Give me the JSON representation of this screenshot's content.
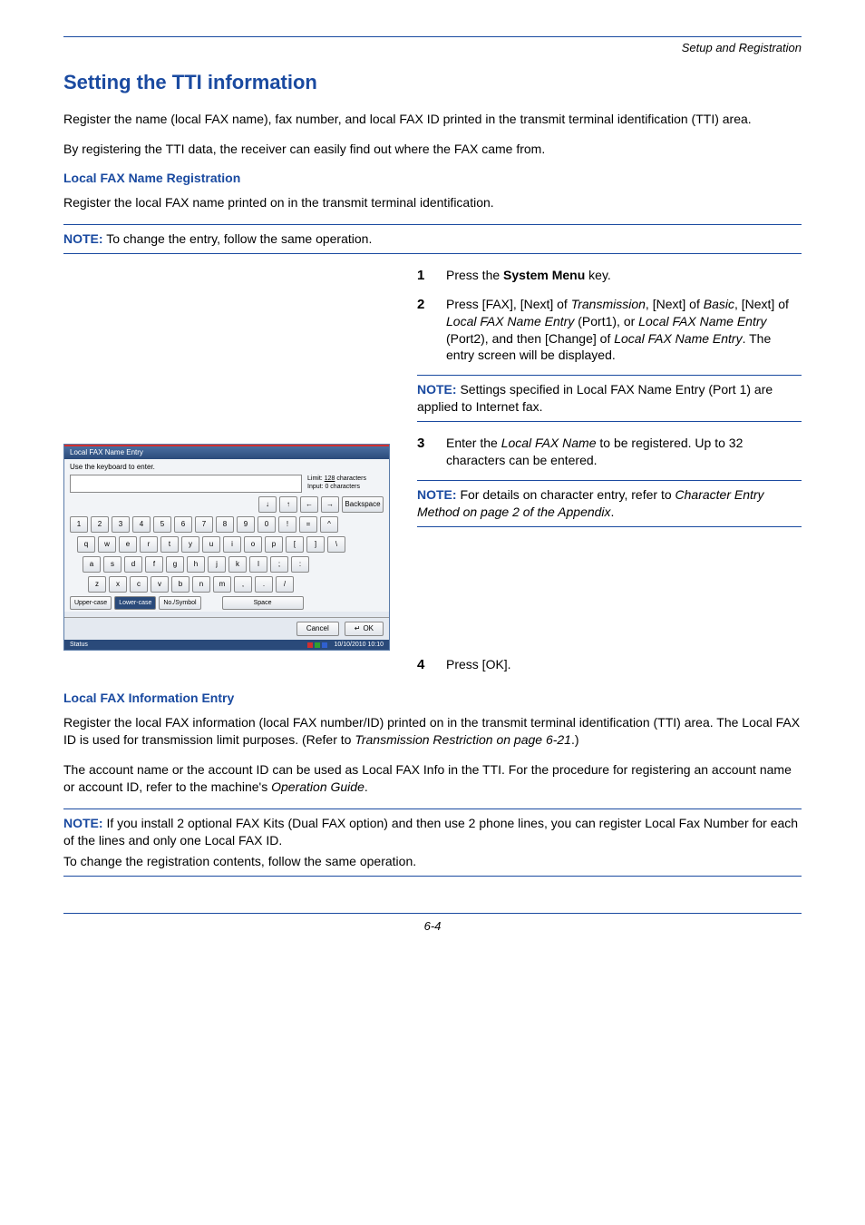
{
  "header": {
    "section": "Setup and Registration"
  },
  "title": "Setting the TTI information",
  "intro1": "Register the name (local FAX name), fax number, and local FAX ID printed in the transmit terminal identification (TTI) area.",
  "intro2": "By registering the TTI data, the receiver can easily find out where the FAX came from.",
  "sub1": {
    "heading": "Local FAX Name Registration",
    "text": "Register the local FAX name printed on in the transmit terminal identification."
  },
  "note1": {
    "label": "NOTE:",
    "text": " To change the entry, follow the same operation."
  },
  "steps": {
    "s1": {
      "num": "1",
      "text_a": "Press the ",
      "bold": "System Menu",
      "text_b": " key."
    },
    "s2": {
      "num": "2",
      "text": "Press [FAX], [Next] of Transmission, [Next] of Basic, [Next] of Local FAX Name Entry (Port1), or Local FAX Name Entry (Port2), and then [Change] of Local FAX Name Entry. The entry screen will be displayed."
    },
    "s3": {
      "num": "3",
      "text": "Enter the Local FAX Name to be registered. Up to 32 characters can be entered."
    },
    "s4": {
      "num": "4",
      "text": "Press [OK]."
    }
  },
  "note2": {
    "label": "NOTE:",
    "text": " Settings specified in Local FAX Name Entry (Port 1) are applied to Internet fax."
  },
  "note3": {
    "label": "NOTE:",
    "text": " For details on character entry, refer to Character Entry Method on page 2 of the Appendix."
  },
  "sub2": {
    "heading": "Local FAX Information Entry",
    "para1": "Register the local FAX information (local FAX number/ID) printed on in the transmit terminal identification (TTI) area. The Local FAX ID is used for transmission limit purposes. (Refer to Transmission Restriction on page 6-21.)",
    "para2": "The account name or the account ID can be used as Local FAX Info in the TTI. For the procedure for registering an account name or account ID, refer to the machine's Operation Guide."
  },
  "note4": {
    "label": "NOTE:",
    "line1": " If you install 2 optional FAX Kits (Dual FAX option) and then use 2 phone lines, you can register Local Fax Number for each of the lines and only one Local FAX ID.",
    "line2": "To change the registration contents, follow the same operation."
  },
  "footer": {
    "page": "6-4"
  },
  "keyboard": {
    "title": "Local FAX Name Entry",
    "instruction": "Use the keyboard to enter.",
    "limit_label": "Limit:",
    "limit_value": "128",
    "limit_unit": "characters",
    "input_label": "Input: 0 characters",
    "arrows": {
      "down": "↓",
      "up": "↑",
      "left": "←",
      "right": "→",
      "backspace": "Backspace"
    },
    "row1": [
      "1",
      "2",
      "3",
      "4",
      "5",
      "6",
      "7",
      "8",
      "9",
      "0",
      "!",
      "=",
      "^"
    ],
    "row2": [
      "q",
      "w",
      "e",
      "r",
      "t",
      "y",
      "u",
      "i",
      "o",
      "p",
      "[",
      "]",
      "\\"
    ],
    "row3": [
      "a",
      "s",
      "d",
      "f",
      "g",
      "h",
      "j",
      "k",
      "l",
      ";",
      ":"
    ],
    "row4": [
      "z",
      "x",
      "c",
      "v",
      "b",
      "n",
      "m",
      ",",
      ".",
      "/"
    ],
    "modes": {
      "upper": "Upper-case",
      "lower": "Lower-case",
      "sym": "No./Symbol",
      "space": "Space"
    },
    "buttons": {
      "cancel": "Cancel",
      "ok": "OK",
      "enter_icon": "↵"
    },
    "status": {
      "label": "Status",
      "datetime": "10/10/2010   10:10"
    }
  }
}
